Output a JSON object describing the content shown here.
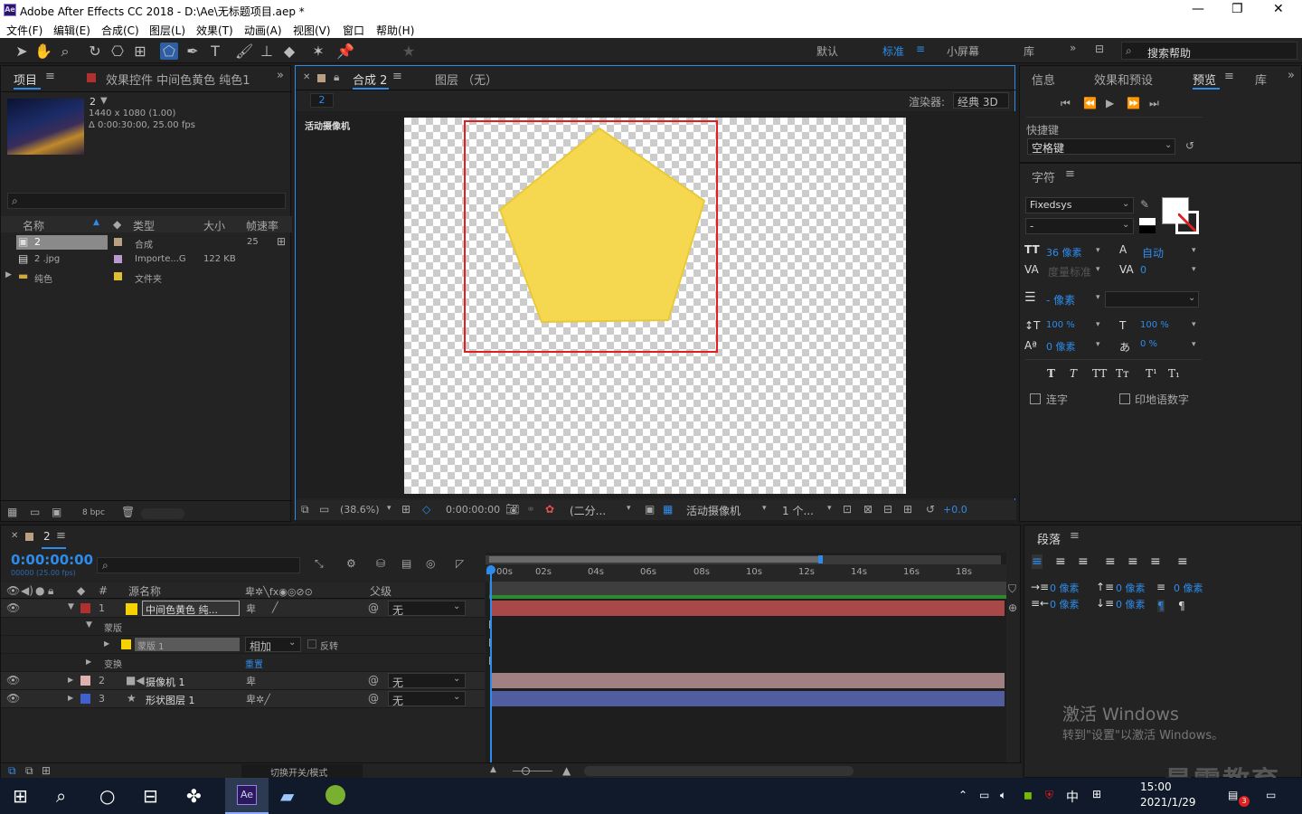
{
  "window": {
    "title": "Adobe After Effects CC 2018 - D:\\Ae\\无标题项目.aep *",
    "app_icon": "Ae"
  },
  "menu": [
    "文件(F)",
    "编辑(E)",
    "合成(C)",
    "图层(L)",
    "效果(T)",
    "动画(A)",
    "视图(V)",
    "窗口",
    "帮助(H)"
  ],
  "workspace": {
    "items": [
      "默认",
      "标准",
      "小屏幕",
      "库"
    ],
    "active": "标准",
    "search_placeholder": "搜索帮助"
  },
  "project": {
    "tab": "项目",
    "fx_tab": "效果控件 中间色黄色 纯色1",
    "comp_name": "2",
    "comp_info1": "1440 x 1080 (1.00)",
    "comp_info2": "Δ 0:00:30:00, 25.00 fps",
    "columns": [
      "名称",
      "类型",
      "大小",
      "帧速率"
    ],
    "items": [
      {
        "name": "2",
        "type": "合成",
        "size": "",
        "fps": "25",
        "color": "#b8a080"
      },
      {
        "name": "2 .jpg",
        "type": "Importe...G",
        "size": "122 KB",
        "fps": "",
        "color": "#b89ad0"
      },
      {
        "name": "纯色",
        "type": "文件夹",
        "size": "",
        "fps": "",
        "color": "#e0c030"
      }
    ],
    "bpc": "8 bpc"
  },
  "composition": {
    "tab": "合成 2",
    "layer_tab": "图层 （无）",
    "sub_tab": "2",
    "renderer_label": "渲染器:",
    "renderer": "经典 3D",
    "camera_label": "活动摄像机",
    "footer": {
      "zoom": "(38.6%)",
      "time": "0:00:00:00",
      "resolution": "(二分...",
      "camera": "活动摄像机",
      "views": "1 个...",
      "exposure": "+0.0"
    }
  },
  "preview": {
    "tabs": [
      "信息",
      "效果和预设",
      "预览",
      "库"
    ],
    "shortcut_label": "快捷键",
    "shortcut_value": "空格键"
  },
  "character": {
    "title": "字符",
    "font": "Fixedsys",
    "style": "-",
    "size": "36 像素",
    "leading": "自动",
    "kerning": "度量标准",
    "tracking": "0",
    "stroke": "- 像素",
    "vscale": "100 %",
    "hscale": "100 %",
    "baseline": "0 像素",
    "tsume": "0 %",
    "ligatures": "连字",
    "hindi": "印地语数字",
    "fmt": [
      "T",
      "T",
      "TT",
      "Tт",
      "T¹",
      "T₁"
    ]
  },
  "paragraph": {
    "title": "段落",
    "indent1": "0 像素",
    "indent2": "0 像素",
    "indent3": "0 像素",
    "space1": "0 像素",
    "space2": "0 像素"
  },
  "timeline": {
    "tab": "2",
    "timecode": "0:00:00:00",
    "frames": "00000 (25.00 fps)",
    "search_placeholder": "",
    "columns": {
      "source": "源名称",
      "parent": "父级"
    },
    "ruler": [
      "00s",
      "02s",
      "04s",
      "06s",
      "08s",
      "10s",
      "12s",
      "14s",
      "16s",
      "18s"
    ],
    "layers": [
      {
        "num": "1",
        "name": "中间色黄色 纯...",
        "label_color": "#b03030",
        "swatch": "#f5d200",
        "parent": "无",
        "bar_color": "#a84848"
      },
      {
        "num": "",
        "name": "蒙版",
        "sub": true
      },
      {
        "num": "",
        "name": "蒙版 1",
        "mode": "相加",
        "invert": "反转",
        "mask": true,
        "swatch": "#f5d200"
      },
      {
        "num": "",
        "name": "变换",
        "reset": "重置"
      },
      {
        "num": "2",
        "name": "摄像机 1",
        "label_color": "#e0b0b0",
        "parent": "无",
        "bar_color": "#a08080"
      },
      {
        "num": "3",
        "name": "形状图层 1",
        "label_color": "#4060d0",
        "parent": "无",
        "bar_color": "#505ea0"
      }
    ],
    "footer": "切换开关/模式"
  },
  "watermark": {
    "line1": "激活 Windows",
    "line2": "转到\"设置\"以激活 Windows。",
    "brand": "最需教育"
  },
  "taskbar": {
    "time": "15:00",
    "date": "2021/1/29",
    "ime": "中",
    "notif": "3"
  }
}
